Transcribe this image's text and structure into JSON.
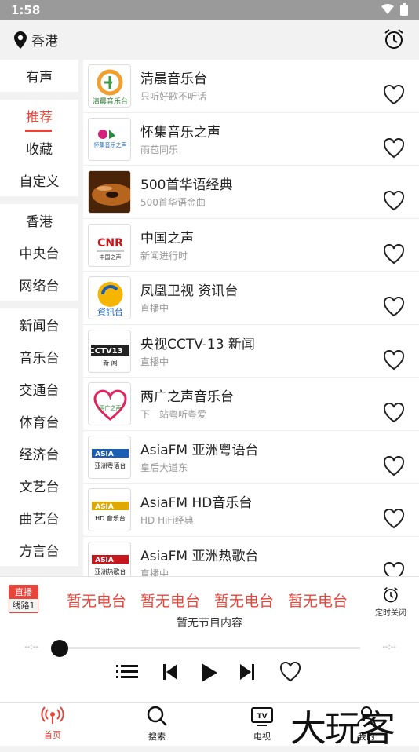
{
  "status": {
    "time": "1:58"
  },
  "topbar": {
    "location": "香港"
  },
  "sidebar": {
    "groups": [
      [
        "有声"
      ],
      [
        "推荐",
        "收藏",
        "自定义"
      ],
      [
        "香港",
        "中央台",
        "网络台"
      ],
      [
        "新闻台",
        "音乐台",
        "交通台",
        "体育台",
        "经济台",
        "文艺台",
        "曲艺台",
        "方言台"
      ]
    ]
  },
  "stations": [
    {
      "title": "清晨音乐台",
      "sub": "只听好歌不听话",
      "logo": "清晨音乐台"
    },
    {
      "title": "怀集音乐之声",
      "sub": "雨苞同乐",
      "logo": "怀集音乐之声"
    },
    {
      "title": "500首华语经典",
      "sub": "500首华语金曲",
      "logo": ""
    },
    {
      "title": "中国之声",
      "sub": "新闻进行时",
      "logo": "CNR"
    },
    {
      "title": "凤凰卫视 资讯台",
      "sub": "直播中",
      "logo": "資訊台"
    },
    {
      "title": "央视CCTV-13 新闻",
      "sub": "直播中",
      "logo": "CCTV13"
    },
    {
      "title": "两广之声音乐台",
      "sub": "下一站粤听粤爱",
      "logo": "两广之声"
    },
    {
      "title": "AsiaFM 亚洲粤语台",
      "sub": "皇后大道东",
      "logo": "ASIA"
    },
    {
      "title": "AsiaFM HD音乐台",
      "sub": "HD HiFi经典",
      "logo": "ASIA"
    },
    {
      "title": "AsiaFM 亚洲热歌台",
      "sub": "直播中",
      "logo": "ASIA"
    }
  ],
  "player": {
    "badge_top": "直播",
    "badge_bottom": "线路1",
    "marquee": [
      "暂无电台",
      "暂无电台",
      "暂无电台",
      "暂无电台"
    ],
    "timer_label": "定时关闭",
    "no_content": "暂无节目内容",
    "time_left": "--:--",
    "time_right": "--:--"
  },
  "tabs": [
    "首页",
    "搜索",
    "电视",
    "我的"
  ],
  "watermark": "大玩客",
  "colors": {
    "accent": "#e8443a"
  }
}
